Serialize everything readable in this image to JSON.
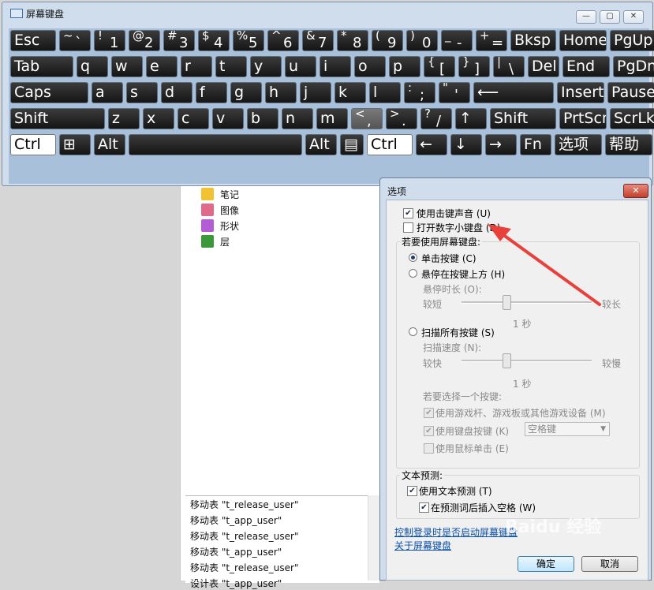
{
  "osk": {
    "title": "屏幕键盘",
    "controls": {
      "minimize": "—",
      "restore": "▢",
      "close": "✕"
    },
    "rows": [
      [
        {
          "name": "esc",
          "label": "Esc"
        },
        {
          "name": "backtick",
          "sup": "~",
          "sub": "`"
        },
        {
          "name": "1",
          "sup": "!",
          "sub": "1"
        },
        {
          "name": "2",
          "sup": "@",
          "sub": "2"
        },
        {
          "name": "3",
          "sup": "#",
          "sub": "3"
        },
        {
          "name": "4",
          "sup": "$",
          "sub": "4"
        },
        {
          "name": "5",
          "sup": "%",
          "sub": "5"
        },
        {
          "name": "6",
          "sup": "^",
          "sub": "6"
        },
        {
          "name": "7",
          "sup": "&",
          "sub": "7"
        },
        {
          "name": "8",
          "sup": "*",
          "sub": "8"
        },
        {
          "name": "9",
          "sup": "(",
          "sub": "9"
        },
        {
          "name": "0",
          "sup": ")",
          "sub": "0"
        },
        {
          "name": "minus",
          "sup": "_",
          "sub": "-"
        },
        {
          "name": "equals",
          "sup": "+",
          "sub": "="
        },
        {
          "name": "bksp",
          "label": "Bksp"
        },
        {
          "name": "home",
          "label": "Home"
        },
        {
          "name": "pgup",
          "label": "PgUp"
        }
      ],
      [
        {
          "name": "tab",
          "label": "Tab"
        },
        {
          "name": "q",
          "label": "q"
        },
        {
          "name": "w",
          "label": "w"
        },
        {
          "name": "e",
          "label": "e"
        },
        {
          "name": "r",
          "label": "r"
        },
        {
          "name": "t",
          "label": "t"
        },
        {
          "name": "y",
          "label": "y"
        },
        {
          "name": "u",
          "label": "u"
        },
        {
          "name": "i",
          "label": "i"
        },
        {
          "name": "o",
          "label": "o"
        },
        {
          "name": "p",
          "label": "p"
        },
        {
          "name": "lbracket",
          "sup": "{",
          "sub": "["
        },
        {
          "name": "rbracket",
          "sup": "}",
          "sub": "]"
        },
        {
          "name": "backslash",
          "sup": "|",
          "sub": "\\"
        },
        {
          "name": "del",
          "label": "Del"
        },
        {
          "name": "end",
          "label": "End"
        },
        {
          "name": "pgdn",
          "label": "PgDn"
        }
      ],
      [
        {
          "name": "caps",
          "label": "Caps"
        },
        {
          "name": "a",
          "label": "a"
        },
        {
          "name": "s",
          "label": "s"
        },
        {
          "name": "d",
          "label": "d"
        },
        {
          "name": "f",
          "label": "f"
        },
        {
          "name": "g",
          "label": "g"
        },
        {
          "name": "h",
          "label": "h"
        },
        {
          "name": "j",
          "label": "j"
        },
        {
          "name": "k",
          "label": "k"
        },
        {
          "name": "l",
          "label": "l"
        },
        {
          "name": "semicolon",
          "sup": ":",
          "sub": ";"
        },
        {
          "name": "quote",
          "sup": "\"",
          "sub": "'"
        },
        {
          "name": "enter",
          "label": "⟵"
        },
        {
          "name": "insert",
          "label": "Insert"
        },
        {
          "name": "pause",
          "label": "Pause"
        }
      ],
      [
        {
          "name": "lshift",
          "label": "Shift"
        },
        {
          "name": "z",
          "label": "z"
        },
        {
          "name": "x",
          "label": "x"
        },
        {
          "name": "c",
          "label": "c"
        },
        {
          "name": "v",
          "label": "v"
        },
        {
          "name": "b",
          "label": "b"
        },
        {
          "name": "n",
          "label": "n"
        },
        {
          "name": "m",
          "label": "m"
        },
        {
          "name": "comma",
          "sup": "<",
          "sub": ","
        },
        {
          "name": "period",
          "sup": ">",
          "sub": "."
        },
        {
          "name": "slash",
          "sup": "?",
          "sub": "/"
        },
        {
          "name": "up",
          "label": "↑"
        },
        {
          "name": "rshift",
          "label": "Shift"
        },
        {
          "name": "prtscn",
          "label": "PrtScn"
        },
        {
          "name": "scrlk",
          "label": "ScrLk"
        }
      ],
      [
        {
          "name": "lctrl",
          "label": "Ctrl"
        },
        {
          "name": "win",
          "label": "⊞"
        },
        {
          "name": "lalt",
          "label": "Alt"
        },
        {
          "name": "space",
          "label": ""
        },
        {
          "name": "ralt",
          "label": "Alt"
        },
        {
          "name": "menu",
          "label": "▤"
        },
        {
          "name": "rctrl",
          "label": "Ctrl"
        },
        {
          "name": "left",
          "label": "←"
        },
        {
          "name": "down",
          "label": "↓"
        },
        {
          "name": "right",
          "label": "→"
        },
        {
          "name": "fn",
          "label": "Fn"
        },
        {
          "name": "options",
          "label": "选项"
        },
        {
          "name": "help",
          "label": "帮助"
        }
      ]
    ]
  },
  "background": {
    "tree": [
      {
        "label": "笔记",
        "icon": "note-icon",
        "color": "#f2c230"
      },
      {
        "label": "图像",
        "icon": "image-icon",
        "color": "#e06a8a"
      },
      {
        "label": "形状",
        "icon": "shape-icon",
        "color": "#b45cd6"
      },
      {
        "label": "层",
        "icon": "layer-icon",
        "color": "#3a9a3a"
      }
    ],
    "log": [
      "移动表 \"t_release_user\"",
      "移动表 \"t_app_user\"",
      "移动表 \"t_release_user\"",
      "移动表 \"t_app_user\"",
      "移动表 \"t_release_user\"",
      "设计表 \"t_app_user\""
    ]
  },
  "dialog": {
    "title": "选项",
    "close": "✕",
    "sound": {
      "label": "使用击键声音 (U)",
      "checked": true
    },
    "numpad": {
      "label": "打开数字小键盘 (D)",
      "checked": false
    },
    "mode_group": "若要使用屏幕键盘:",
    "click_keys": "单击按键 (C)",
    "hover_keys": "悬停在按键上方 (H)",
    "hover_duration": "悬停时长 (O):",
    "short": "较短",
    "long": "较长",
    "hover_value": "1 秒",
    "scan_keys": "扫描所有按键 (S)",
    "scan_speed": "扫描速度 (N):",
    "fast": "较快",
    "slow": "较慢",
    "scan_value": "1 秒",
    "select_key": "若要选择一个按键:",
    "joystick": "使用游戏杆、游戏板或其他游戏设备 (M)",
    "keyboard_key": "使用键盘按键 (K)",
    "keyboard_key_value": "空格键",
    "mouse_click": "使用鼠标单击 (E)",
    "prediction_group": "文本预测:",
    "use_prediction": "使用文本预测 (T)",
    "insert_space": "在预测词后插入空格 (W)",
    "link1": "控制登录时是否启动屏幕键盘",
    "link2": "关于屏幕键盘",
    "ok": "确定",
    "cancel": "取消"
  },
  "watermark": "Baidu 经验",
  "colors": {
    "annotation_arrow": "#e8403a",
    "title_bar": "#cfdded",
    "key_dark": "#1f1f1f",
    "link": "#0a4fa8"
  }
}
